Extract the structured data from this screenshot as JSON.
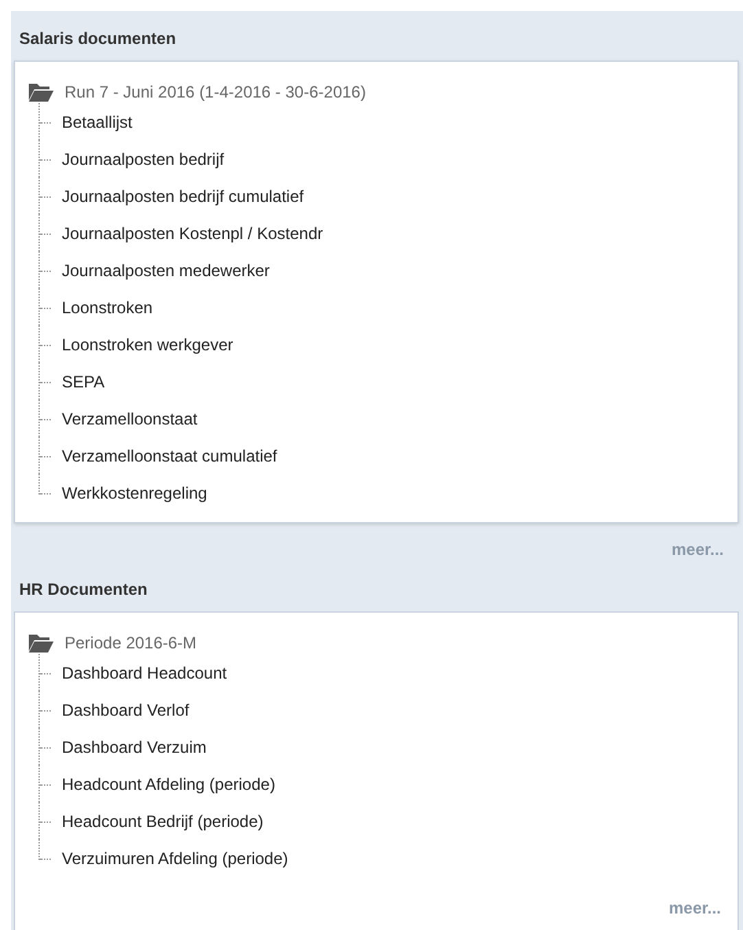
{
  "sections": [
    {
      "title": "Salaris documenten",
      "folder": {
        "label": "Run 7 - Juni 2016 (1-4-2016 - 30-6-2016)",
        "children": [
          {
            "label": "Betaallijst"
          },
          {
            "label": "Journaalposten bedrijf"
          },
          {
            "label": "Journaalposten bedrijf cumulatief"
          },
          {
            "label": "Journaalposten Kostenpl / Kostendr"
          },
          {
            "label": "Journaalposten medewerker"
          },
          {
            "label": "Loonstroken"
          },
          {
            "label": "Loonstroken werkgever"
          },
          {
            "label": "SEPA"
          },
          {
            "label": "Verzamelloonstaat"
          },
          {
            "label": "Verzamelloonstaat cumulatief"
          },
          {
            "label": "Werkkostenregeling"
          }
        ]
      },
      "more": "meer..."
    },
    {
      "title": "HR Documenten",
      "folder": {
        "label": "Periode 2016-6-M",
        "children": [
          {
            "label": "Dashboard Headcount"
          },
          {
            "label": "Dashboard Verlof"
          },
          {
            "label": "Dashboard Verzuim"
          },
          {
            "label": "Headcount Afdeling (periode)"
          },
          {
            "label": "Headcount Bedrijf (periode)"
          },
          {
            "label": "Verzuimuren Afdeling (periode)"
          }
        ]
      },
      "more": "meer..."
    }
  ]
}
